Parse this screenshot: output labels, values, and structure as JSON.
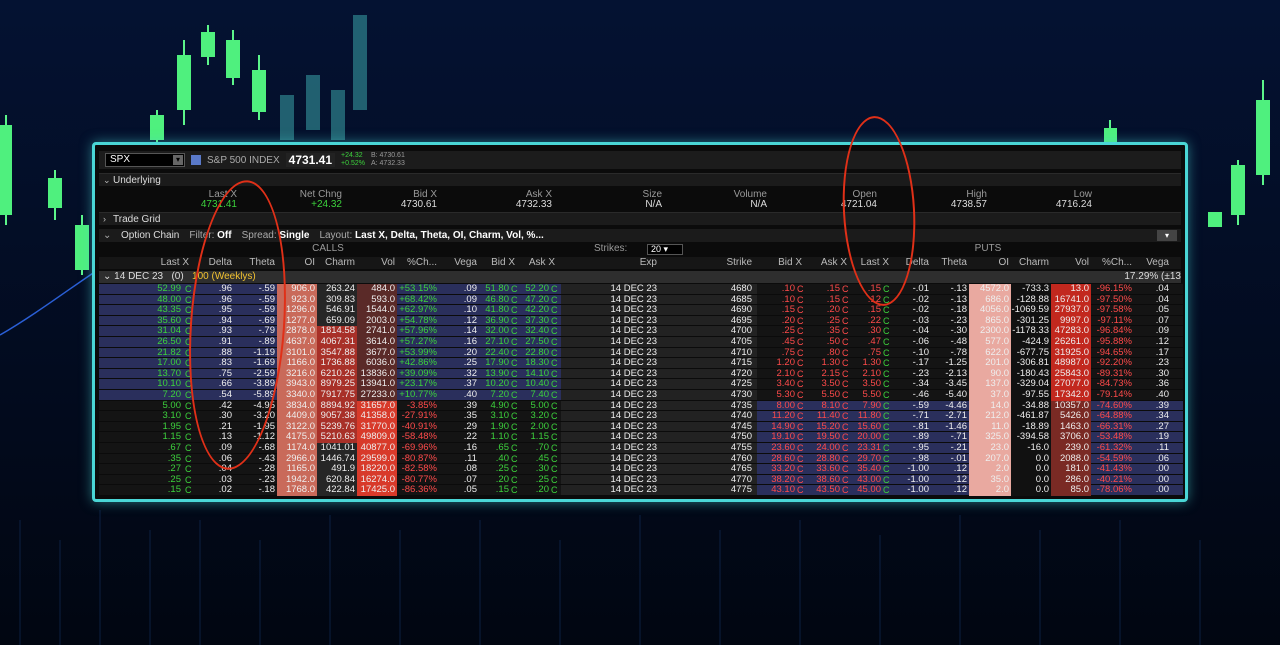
{
  "symbol_bar": {
    "symbol": "SPX",
    "name": "S&P 500 INDEX",
    "last": "4731.41",
    "change": "+24.32",
    "change_pct": "+0.52%",
    "bid": "B: 4730.61",
    "ask": "A: 4732.33"
  },
  "underlying": {
    "label": "Underlying",
    "headers": [
      "Last X",
      "Net Chng",
      "Bid X",
      "Ask X",
      "Size",
      "Volume",
      "Open",
      "High",
      "Low"
    ],
    "values": [
      "4731.41",
      "+24.32",
      "4730.61",
      "4732.33",
      "N/A",
      "N/A",
      "4721.04",
      "4738.57",
      "4716.24"
    ]
  },
  "trade_grid": {
    "label": "Trade Grid"
  },
  "chain_bar": {
    "label": "Option Chain",
    "filter_label": "Filter:",
    "filter_value": "Off",
    "spread_label": "Spread:",
    "spread_value": "Single",
    "layout_label": "Layout:",
    "layout_value": "Last X, Delta, Theta, OI, Charm, Vol, %..."
  },
  "section_headers": {
    "calls": "CALLS",
    "puts": "PUTS",
    "strikes_label": "Strikes:",
    "strikes_value": "20"
  },
  "call_headers": [
    "Last X",
    "Delta",
    "Theta",
    "OI",
    "Charm",
    "Vol",
    "%Ch...",
    "Vega",
    "Bid X",
    "Ask X"
  ],
  "mid_headers": [
    "Exp",
    "Strike"
  ],
  "put_headers": [
    "Bid X",
    "Ask X",
    "Last X",
    "Delta",
    "Theta",
    "OI",
    "Charm",
    "Vol",
    "%Ch...",
    "Vega"
  ],
  "expiry_row": {
    "date": "14 DEC 23",
    "count": "(0)",
    "multiplier": "100",
    "weeklies": "(Weeklys)",
    "iv": "17.29% (±13"
  },
  "colors": {
    "frame": "#4ad6d6",
    "itm_call_row": "#2a2f55",
    "otm_row": "#151515",
    "itm_put_row": "#2a2f55",
    "annotation": "#e03018",
    "up": "#3cd23c",
    "down": "#ff4a4a"
  },
  "rows": [
    {
      "c": [
        "52.99",
        "C",
        ".96",
        "-.59",
        "906.0",
        "263.24",
        "484.0",
        "+53.15%",
        ".09",
        "51.80",
        "C",
        "52.20",
        "C"
      ],
      "exp": "14 DEC 23",
      "k": "4680",
      "p": [
        ".10",
        "C",
        ".15",
        "C",
        ".15",
        "C",
        "-.01",
        "-.13",
        "4572.0",
        "-733.3",
        "13.0",
        "-96.15%",
        ".04"
      ]
    },
    {
      "c": [
        "48.00",
        "C",
        ".96",
        "-.59",
        "923.0",
        "309.83",
        "593.0",
        "+68.42%",
        ".09",
        "46.80",
        "C",
        "47.20",
        "C"
      ],
      "exp": "14 DEC 23",
      "k": "4685",
      "p": [
        ".10",
        "C",
        ".15",
        "C",
        ".12",
        "C",
        "-.02",
        "-.13",
        "686.0",
        "-128.88",
        "16741.0",
        "-97.50%",
        ".04"
      ]
    },
    {
      "c": [
        "43.35",
        "C",
        ".95",
        "-.59",
        "1296.0",
        "546.91",
        "1544.0",
        "+62.97%",
        ".10",
        "41.80",
        "C",
        "42.20",
        "C"
      ],
      "exp": "14 DEC 23",
      "k": "4690",
      "p": [
        ".15",
        "C",
        ".20",
        "C",
        ".15",
        "C",
        "-.02",
        "-.18",
        "4056.0",
        "-1069.59",
        "27937.0",
        "-97.58%",
        ".05"
      ]
    },
    {
      "c": [
        "35.60",
        "C",
        ".94",
        "-.69",
        "1277.0",
        "659.09",
        "2003.0",
        "+54.78%",
        ".12",
        "36.90",
        "C",
        "37.30",
        "C"
      ],
      "exp": "14 DEC 23",
      "k": "4695",
      "p": [
        ".20",
        "C",
        ".25",
        "C",
        ".22",
        "C",
        "-.03",
        "-.23",
        "865.0",
        "-301.25",
        "9997.0",
        "-97.11%",
        ".07"
      ]
    },
    {
      "c": [
        "31.04",
        "C",
        ".93",
        "-.79",
        "2878.0",
        "1814.58",
        "2741.0",
        "+57.96%",
        ".14",
        "32.00",
        "C",
        "32.40",
        "C"
      ],
      "exp": "14 DEC 23",
      "k": "4700",
      "p": [
        ".25",
        "C",
        ".35",
        "C",
        ".30",
        "C",
        "-.04",
        "-.30",
        "2300.0",
        "-1178.33",
        "47283.0",
        "-96.84%",
        ".09"
      ]
    },
    {
      "c": [
        "26.50",
        "C",
        ".91",
        "-.89",
        "4637.0",
        "4067.31",
        "3614.0",
        "+57.27%",
        ".16",
        "27.10",
        "C",
        "27.50",
        "C"
      ],
      "exp": "14 DEC 23",
      "k": "4705",
      "p": [
        ".45",
        "C",
        ".50",
        "C",
        ".47",
        "C",
        "-.06",
        "-.48",
        "577.0",
        "-424.9",
        "26261.0",
        "-95.88%",
        ".12"
      ]
    },
    {
      "c": [
        "21.82",
        "C",
        ".88",
        "-1.19",
        "3101.0",
        "3547.88",
        "3677.0",
        "+53.99%",
        ".20",
        "22.40",
        "C",
        "22.80",
        "C"
      ],
      "exp": "14 DEC 23",
      "k": "4710",
      "p": [
        ".75",
        "C",
        ".80",
        "C",
        ".75",
        "C",
        "-.10",
        "-.78",
        "622.0",
        "-677.75",
        "31925.0",
        "-94.65%",
        ".17"
      ]
    },
    {
      "c": [
        "17.00",
        "C",
        ".83",
        "-1.69",
        "1166.0",
        "1736.88",
        "6036.0",
        "+42.86%",
        ".25",
        "17.90",
        "C",
        "18.30",
        "C"
      ],
      "exp": "14 DEC 23",
      "k": "4715",
      "p": [
        "1.20",
        "C",
        "1.30",
        "C",
        "1.30",
        "C",
        "-.17",
        "-1.25",
        "201.0",
        "-306.81",
        "48987.0",
        "-92.20%",
        ".23"
      ]
    },
    {
      "c": [
        "13.70",
        "C",
        ".75",
        "-2.59",
        "3216.0",
        "6210.26",
        "13836.0",
        "+39.09%",
        ".32",
        "13.90",
        "C",
        "14.10",
        "C"
      ],
      "exp": "14 DEC 23",
      "k": "4720",
      "p": [
        "2.10",
        "C",
        "2.15",
        "C",
        "2.10",
        "C",
        "-.23",
        "-2.13",
        "90.0",
        "-180.43",
        "25843.0",
        "-89.31%",
        ".30"
      ]
    },
    {
      "c": [
        "10.10",
        "C",
        ".66",
        "-3.89",
        "3943.0",
        "8979.25",
        "13941.0",
        "+23.17%",
        ".37",
        "10.20",
        "C",
        "10.40",
        "C"
      ],
      "exp": "14 DEC 23",
      "k": "4725",
      "p": [
        "3.40",
        "C",
        "3.50",
        "C",
        "3.50",
        "C",
        "-.34",
        "-3.45",
        "137.0",
        "-329.04",
        "27077.0",
        "-84.73%",
        ".36"
      ]
    },
    {
      "c": [
        "7.20",
        "C",
        ".54",
        "-5.89",
        "3340.0",
        "7917.75",
        "27233.0",
        "+10.77%",
        ".40",
        "7.20",
        "C",
        "7.40",
        "C"
      ],
      "exp": "14 DEC 23",
      "k": "4730",
      "p": [
        "5.30",
        "C",
        "5.50",
        "C",
        "5.50",
        "C",
        "-.46",
        "-5.40",
        "37.0",
        "-97.55",
        "17342.0",
        "-79.14%",
        ".40"
      ]
    },
    {
      "c": [
        "5.00",
        "C",
        ".42",
        "-4.95",
        "3834.0",
        "8894.92",
        "31657.0",
        "-3.85%",
        ".39",
        "4.90",
        "C",
        "5.00",
        "C"
      ],
      "exp": "14 DEC 23",
      "k": "4735",
      "p": [
        "8.00",
        "C",
        "8.10",
        "C",
        "7.90",
        "C",
        "-.59",
        "-4.46",
        "14.0",
        "-34.88",
        "10357.0",
        "-74.60%",
        ".39"
      ]
    },
    {
      "c": [
        "3.10",
        "C",
        ".30",
        "-3.20",
        "4409.0",
        "9057.38",
        "41358.0",
        "-27.91%",
        ".35",
        "3.10",
        "C",
        "3.20",
        "C"
      ],
      "exp": "14 DEC 23",
      "k": "4740",
      "p": [
        "11.20",
        "C",
        "11.40",
        "C",
        "11.80",
        "C",
        "-.71",
        "-2.71",
        "212.0",
        "-461.87",
        "5426.0",
        "-64.88%",
        ".34"
      ]
    },
    {
      "c": [
        "1.95",
        "C",
        ".21",
        "-1.95",
        "3122.0",
        "5239.76",
        "31770.0",
        "-40.91%",
        ".29",
        "1.90",
        "C",
        "2.00",
        "C"
      ],
      "exp": "14 DEC 23",
      "k": "4745",
      "p": [
        "14.90",
        "C",
        "15.20",
        "C",
        "15.60",
        "C",
        "-.81",
        "-1.46",
        "11.0",
        "-18.89",
        "1463.0",
        "-66.31%",
        ".27"
      ]
    },
    {
      "c": [
        "1.15",
        "C",
        ".13",
        "-1.12",
        "4175.0",
        "5210.63",
        "49809.0",
        "-58.48%",
        ".22",
        "1.10",
        "C",
        "1.15",
        "C"
      ],
      "exp": "14 DEC 23",
      "k": "4750",
      "p": [
        "19.10",
        "C",
        "19.50",
        "C",
        "20.00",
        "C",
        "-.89",
        "-.71",
        "325.0",
        "-394.58",
        "3706.0",
        "-53.48%",
        ".19"
      ]
    },
    {
      "c": [
        ".67",
        "C",
        ".09",
        "-.68",
        "1174.0",
        "1041.01",
        "40877.0",
        "-69.96%",
        ".16",
        ".65",
        "C",
        ".70",
        "C"
      ],
      "exp": "14 DEC 23",
      "k": "4755",
      "p": [
        "23.60",
        "C",
        "24.00",
        "C",
        "23.31",
        "C",
        "-.95",
        "-.21",
        "23.0",
        "-16.0",
        "239.0",
        "-61.32%",
        ".11"
      ]
    },
    {
      "c": [
        ".35",
        "C",
        ".06",
        "-.43",
        "2966.0",
        "1446.74",
        "29599.0",
        "-80.87%",
        ".11",
        ".40",
        "C",
        ".45",
        "C"
      ],
      "exp": "14 DEC 23",
      "k": "4760",
      "p": [
        "28.60",
        "C",
        "28.80",
        "C",
        "29.70",
        "C",
        "-.98",
        "-.01",
        "207.0",
        "0.0",
        "2088.0",
        "-54.59%",
        ".06"
      ]
    },
    {
      "c": [
        ".27",
        "C",
        ".04",
        "-.28",
        "1165.0",
        "491.9",
        "18220.0",
        "-82.58%",
        ".08",
        ".25",
        "C",
        ".30",
        "C"
      ],
      "exp": "14 DEC 23",
      "k": "4765",
      "p": [
        "33.20",
        "C",
        "33.60",
        "C",
        "35.40",
        "C",
        "-1.00",
        ".12",
        "2.0",
        "0.0",
        "181.0",
        "-41.43%",
        ".00"
      ]
    },
    {
      "c": [
        ".25",
        "C",
        ".03",
        "-.23",
        "1942.0",
        "620.84",
        "16274.0",
        "-80.77%",
        ".07",
        ".20",
        "C",
        ".25",
        "C"
      ],
      "exp": "14 DEC 23",
      "k": "4770",
      "p": [
        "38.20",
        "C",
        "38.60",
        "C",
        "43.00",
        "C",
        "-1.00",
        ".12",
        "35.0",
        "0.0",
        "286.0",
        "-40.21%",
        ".00"
      ]
    },
    {
      "c": [
        ".15",
        "C",
        ".02",
        "-.18",
        "1768.0",
        "422.84",
        "17425.0",
        "-86.36%",
        ".05",
        ".15",
        "C",
        ".20",
        "C"
      ],
      "exp": "14 DEC 23",
      "k": "4775",
      "p": [
        "43.10",
        "C",
        "43.50",
        "C",
        "45.00",
        "C",
        "-1.00",
        ".12",
        "2.0",
        "0.0",
        "85.0",
        "-78.06%",
        ".00"
      ]
    }
  ]
}
